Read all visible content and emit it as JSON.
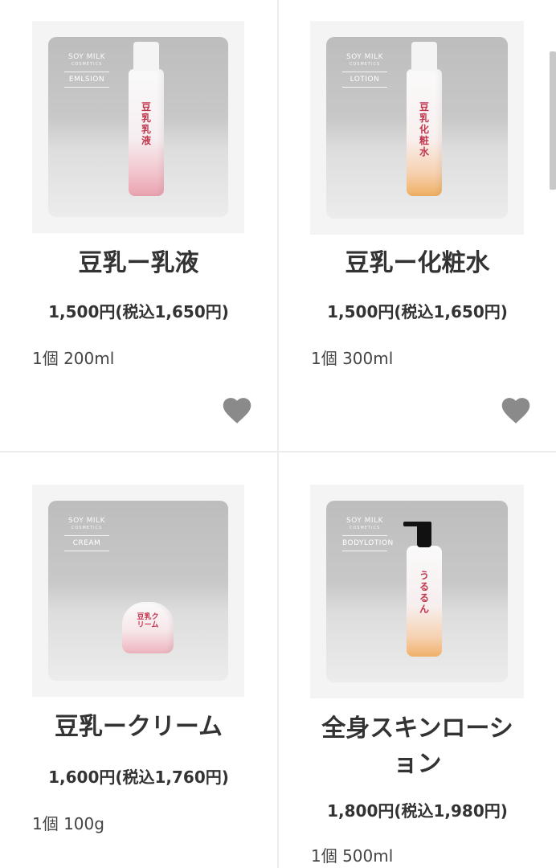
{
  "products": [
    {
      "name": "豆乳ー乳液",
      "price": "1,500円(税込1,650円)",
      "quantity": "1個 200ml",
      "image": {
        "brand_line1": "SOY MILK",
        "brand_line2": "COSMETICS",
        "category": "EMLSION",
        "bottle_label": "豆乳乳液"
      }
    },
    {
      "name": "豆乳ー化粧水",
      "price": "1,500円(税込1,650円)",
      "quantity": "1個 300ml",
      "image": {
        "brand_line1": "SOY MILK",
        "brand_line2": "COSMETICS",
        "category": "LOTION",
        "bottle_label": "豆乳化粧水"
      }
    },
    {
      "name": "豆乳ークリーム",
      "price": "1,600円(税込1,760円)",
      "quantity": "1個 100g",
      "image": {
        "brand_line1": "SOY MILK",
        "brand_line2": "COSMETICS",
        "category": "CREAM",
        "bottle_label": "豆乳クリーム"
      }
    },
    {
      "name": "全身スキンローション",
      "price": "1,800円(税込1,980円)",
      "quantity": "1個 500ml",
      "image": {
        "brand_line1": "SOY MILK",
        "brand_line2": "COSMETICS",
        "category": "BODYLOTION",
        "bottle_label": "うるるん"
      }
    }
  ],
  "icons": {
    "favorite": "heart-icon"
  },
  "colors": {
    "heart": "#8a8a8a",
    "accent_text": "#c2364e",
    "divider": "#ececec"
  }
}
